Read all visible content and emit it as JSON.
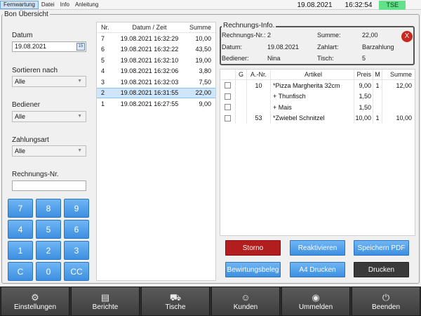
{
  "menu": {
    "items": [
      "Fernwartung",
      "Datei",
      "Info",
      "Anleitung"
    ],
    "active_index": 0
  },
  "status": {
    "date": "19.08.2021",
    "time": "16:32:54",
    "tse": "TSE",
    "tse_color": "#63e08a"
  },
  "frame_title": "Bon Übersicht",
  "filters": {
    "date_label": "Datum",
    "date_value": "19.08.2021",
    "sort_label": "Sortieren nach",
    "sort_value": "Alle",
    "waiter_label": "Bediener",
    "waiter_value": "Alle",
    "payment_label": "Zahlungsart",
    "payment_value": "Alle",
    "billno_label": "Rechnungs-Nr.",
    "billno_value": ""
  },
  "numpad": [
    "7",
    "8",
    "9",
    "4",
    "5",
    "6",
    "1",
    "2",
    "3",
    "C",
    "0",
    "CC"
  ],
  "bills": {
    "headers": [
      "Nr.",
      "Datum / Zeit",
      "Summe"
    ],
    "rows": [
      {
        "nr": "7",
        "datetime": "19.08.2021 16:32:29",
        "sum": "10,00"
      },
      {
        "nr": "6",
        "datetime": "19.08.2021 16:32:22",
        "sum": "43,50"
      },
      {
        "nr": "5",
        "datetime": "19.08.2021 16:32:10",
        "sum": "19,00"
      },
      {
        "nr": "4",
        "datetime": "19.08.2021 16:32:06",
        "sum": "3,80"
      },
      {
        "nr": "3",
        "datetime": "19.08.2021 16:32:03",
        "sum": "7,50"
      },
      {
        "nr": "2",
        "datetime": "19.08.2021 16:31:55",
        "sum": "22,00"
      },
      {
        "nr": "1",
        "datetime": "19.08.2021 16:27:55",
        "sum": "9,00"
      }
    ],
    "selected_index": 5
  },
  "info": {
    "title": "Rechnungs-Info.",
    "billno_label": "Rechnungs-Nr.:",
    "billno_value": "2",
    "date_label": "Datum:",
    "date_value": "19.08.2021",
    "waiter_label": "Bediener:",
    "waiter_value": "Nina",
    "sum_label": "Summe:",
    "sum_value": "22,00",
    "payment_label": "Zahlart:",
    "payment_value": "Barzahlung",
    "table_label": "Tisch:",
    "table_value": "5",
    "close_label": "X"
  },
  "items": {
    "headers": [
      "G",
      "A.-Nr.",
      "Artikel",
      "Preis",
      "M",
      "Summe"
    ],
    "rows": [
      {
        "g": "",
        "anr": "10",
        "article": "*Pizza Margherita 32cm",
        "price": "9,00",
        "qty": "1",
        "sum": "12,00"
      },
      {
        "g": "",
        "anr": "",
        "article": "+ Thunfisch",
        "price": "1,50",
        "qty": "",
        "sum": ""
      },
      {
        "g": "",
        "anr": "",
        "article": "+ Mais",
        "price": "1,50",
        "qty": "",
        "sum": ""
      },
      {
        "g": "",
        "anr": "53",
        "article": "*Zwiebel Schnitzel",
        "price": "10,00",
        "qty": "1",
        "sum": "10,00"
      }
    ]
  },
  "actions": {
    "storno": "Storno",
    "reactivate": "Reaktivieren",
    "save_pdf": "Speichern PDF",
    "entertainment_receipt": "Bewirtungsbeleg",
    "a4_print": "A4 Drucken",
    "print": "Drucken"
  },
  "bottom": [
    {
      "label": "Einstellungen",
      "icon": "gear-icon"
    },
    {
      "label": "Berichte",
      "icon": "clipboard-icon"
    },
    {
      "label": "Tische",
      "icon": "table-icon"
    },
    {
      "label": "Kunden",
      "icon": "users-icon"
    },
    {
      "label": "Ummelden",
      "icon": "user-switch-icon"
    },
    {
      "label": "Beenden",
      "icon": "power-icon"
    }
  ]
}
